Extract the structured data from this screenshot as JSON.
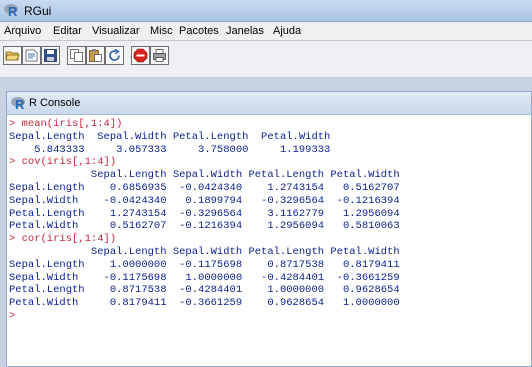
{
  "window": {
    "title": "RGui"
  },
  "menu": [
    "Arquivo",
    "Editar",
    "Visualizar",
    "Misc",
    "Pacotes",
    "Janelas",
    "Ajuda"
  ],
  "toolbar": {
    "buttons": [
      {
        "name": "open-script-button",
        "icon": "open-folder-icon"
      },
      {
        "name": "load-workspace-button",
        "icon": "load-workspace-icon"
      },
      {
        "name": "save-button",
        "icon": "save-disk-icon"
      },
      {
        "name": "copy-button",
        "icon": "copy-icon"
      },
      {
        "name": "paste-button",
        "icon": "paste-icon"
      },
      {
        "name": "refresh-button",
        "icon": "refresh-icon"
      },
      {
        "name": "stop-button",
        "icon": "stop-icon"
      },
      {
        "name": "print-button",
        "icon": "printer-icon"
      }
    ]
  },
  "console": {
    "title": "R Console",
    "lines": [
      {
        "type": "cmd",
        "text": "> mean(iris[,1:4])"
      },
      {
        "type": "out",
        "text": "Sepal.Length  Sepal.Width Petal.Length  Petal.Width"
      },
      {
        "type": "out",
        "text": "    5.843333     3.057333     3.758000     1.199333"
      },
      {
        "type": "cmd",
        "text": "> cov(iris[,1:4])"
      },
      {
        "type": "out",
        "text": "             Sepal.Length Sepal.Width Petal.Length Petal.Width"
      },
      {
        "type": "out",
        "text": "Sepal.Length    0.6856935  -0.0424340    1.2743154   0.5162707"
      },
      {
        "type": "out",
        "text": "Sepal.Width    -0.0424340   0.1899794   -0.3296564  -0.1216394"
      },
      {
        "type": "out",
        "text": "Petal.Length    1.2743154  -0.3296564    3.1162779   1.2956094"
      },
      {
        "type": "out",
        "text": "Petal.Width     0.5162707  -0.1216394    1.2956094   0.5810063"
      },
      {
        "type": "cmd",
        "text": "> cor(iris[,1:4])"
      },
      {
        "type": "out",
        "text": "             Sepal.Length Sepal.Width Petal.Length Petal.Width"
      },
      {
        "type": "out",
        "text": "Sepal.Length    1.0000000  -0.1175698    0.8717538   0.8179411"
      },
      {
        "type": "out",
        "text": "Sepal.Width    -0.1175698   1.0000000   -0.4284401  -0.3661259"
      },
      {
        "type": "out",
        "text": "Petal.Length    0.8717538  -0.4284401    1.0000000   0.9628654"
      },
      {
        "type": "out",
        "text": "Petal.Width     0.8179411  -0.3661259    0.9628654   1.0000000"
      },
      {
        "type": "cmd",
        "text": ">"
      }
    ]
  },
  "colors": {
    "prompt": "#c8283c",
    "output": "#0b1f8c",
    "r_logo": "#2266b8"
  }
}
